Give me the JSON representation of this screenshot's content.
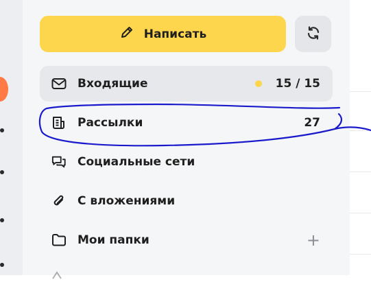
{
  "compose": {
    "label": "Написать"
  },
  "folders": [
    {
      "label": "Входящие",
      "counter": "15 / 15"
    },
    {
      "label": "Рассылки",
      "counter": "27"
    },
    {
      "label": "Социальные сети"
    },
    {
      "label": "С вложениями"
    },
    {
      "label": "Мои папки",
      "action": "+"
    }
  ],
  "colors": {
    "accent": "#fdd64e",
    "annotation": "#1a1acc",
    "avatar": "#ff7a45"
  }
}
